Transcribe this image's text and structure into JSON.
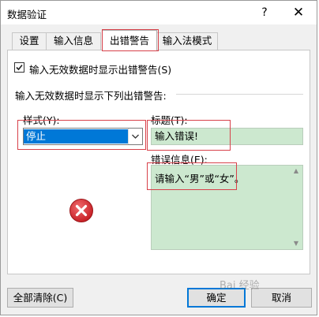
{
  "window": {
    "title": "数据验证",
    "help_label": "?",
    "close_label": "✕"
  },
  "tabs": [
    {
      "label": "设置"
    },
    {
      "label": "输入信息"
    },
    {
      "label": "出错警告"
    },
    {
      "label": "输入法模式"
    }
  ],
  "active_tab": "出错警告",
  "show_error_checkbox": {
    "checked": true,
    "label": "输入无效数据时显示出错警告(S)"
  },
  "group_label": "输入无效数据时显示下列出错警告:",
  "style_field": {
    "label": "样式(Y):",
    "value": "停止",
    "icon": "error-stop-icon"
  },
  "title_field": {
    "label": "标题(T):",
    "value": "输入错误!"
  },
  "message_field": {
    "label": "错误信息(E):",
    "value": "请输入“男”或“女”。"
  },
  "buttons": {
    "clear_all": "全部清除(C)",
    "ok": "确定",
    "cancel": "取消"
  },
  "watermark": "Bai 经验",
  "colors": {
    "highlight_box": "#d8414a",
    "selection": "#0078d7",
    "input_bg": "#cce8cf",
    "error_icon": "#d9262b"
  }
}
